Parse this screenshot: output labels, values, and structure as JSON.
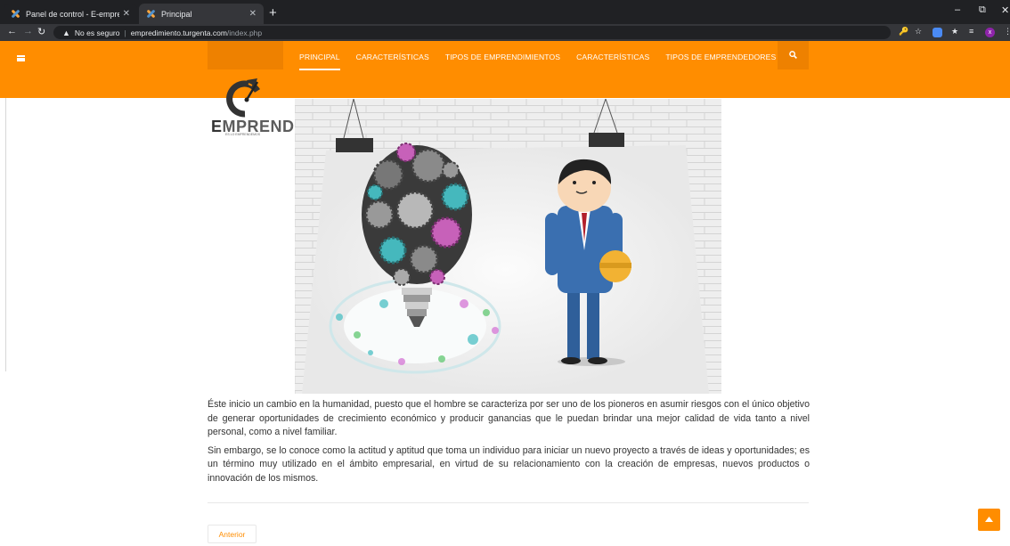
{
  "browser": {
    "tabs": [
      {
        "title": "Panel de control - E-emprendimie",
        "close": "✕",
        "active": false
      },
      {
        "title": "Principal",
        "close": "✕",
        "active": true
      }
    ],
    "new_tab": "+",
    "security_label": "No es seguro",
    "url_host": "empredimiento.turgenta.com",
    "url_path": "/index.php",
    "profile_initial": "x"
  },
  "site": {
    "accent_color": "#ff8d00",
    "nav": [
      {
        "label": "PRINCIPAL",
        "active": true
      },
      {
        "label": "CARACTERÍSTICAS",
        "active": false
      },
      {
        "label": "TIPOS DE EMPRENDIMIENTOS",
        "active": false
      },
      {
        "label": "CARACTERÍSTICAS",
        "active": false
      },
      {
        "label": "TIPOS DE EMPRENDEDORES",
        "active": false
      }
    ],
    "logo_first_letter": "E",
    "logo_rest": "MPRENDER",
    "logo_tagline": "ES LO EMPRENDEMOS"
  },
  "article": {
    "paragraphs": [
      "Éste inicio un cambio en la humanidad, puesto que el hombre se caracteriza por ser uno de los pioneros en asumir riesgos con el único objetivo de generar oportunidades de crecimiento económico y producir ganancias que le puedan brindar una mejor calidad de vida tanto a nivel personal, como a nivel familiar.",
      "Sin embargo, se lo conoce como la actitud y aptitud que toma un individuo para iniciar un nuevo proyecto a través de ideas y oportunidades; es un término muy utilizado en el ámbito empresarial, en virtud de su relacionamiento con la creación de empresas, nuevos productos o innovación de los mismos."
    ],
    "prev_button": "Anterior"
  }
}
